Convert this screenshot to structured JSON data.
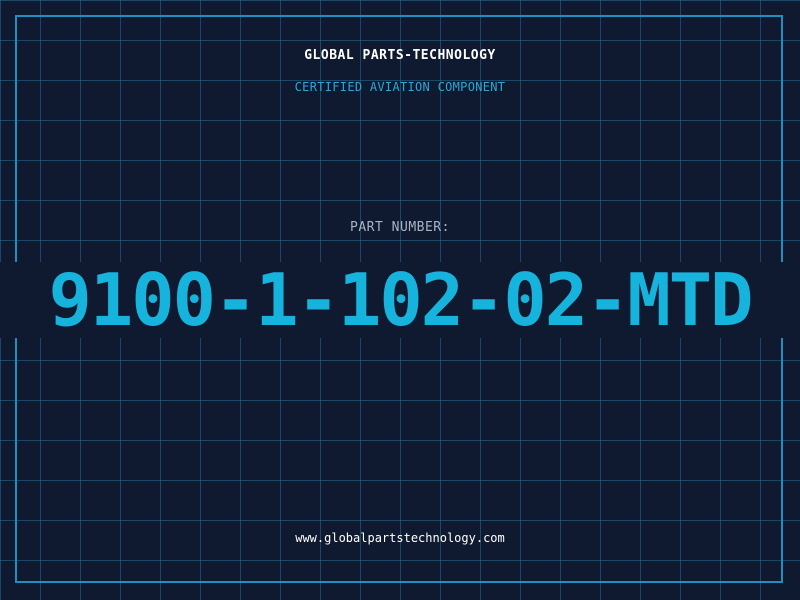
{
  "header": {
    "company": "GLOBAL PARTS-TECHNOLOGY",
    "subtitle": "CERTIFIED AVIATION COMPONENT"
  },
  "part": {
    "label": "PART NUMBER:",
    "number": "9100-1-102-02-MTD"
  },
  "footer": {
    "website": "www.globalpartstechnology.com"
  },
  "colors": {
    "background": "#0f1a30",
    "grid": "#266e96",
    "frame": "#1f8fbf",
    "accent": "#16b3dc"
  }
}
